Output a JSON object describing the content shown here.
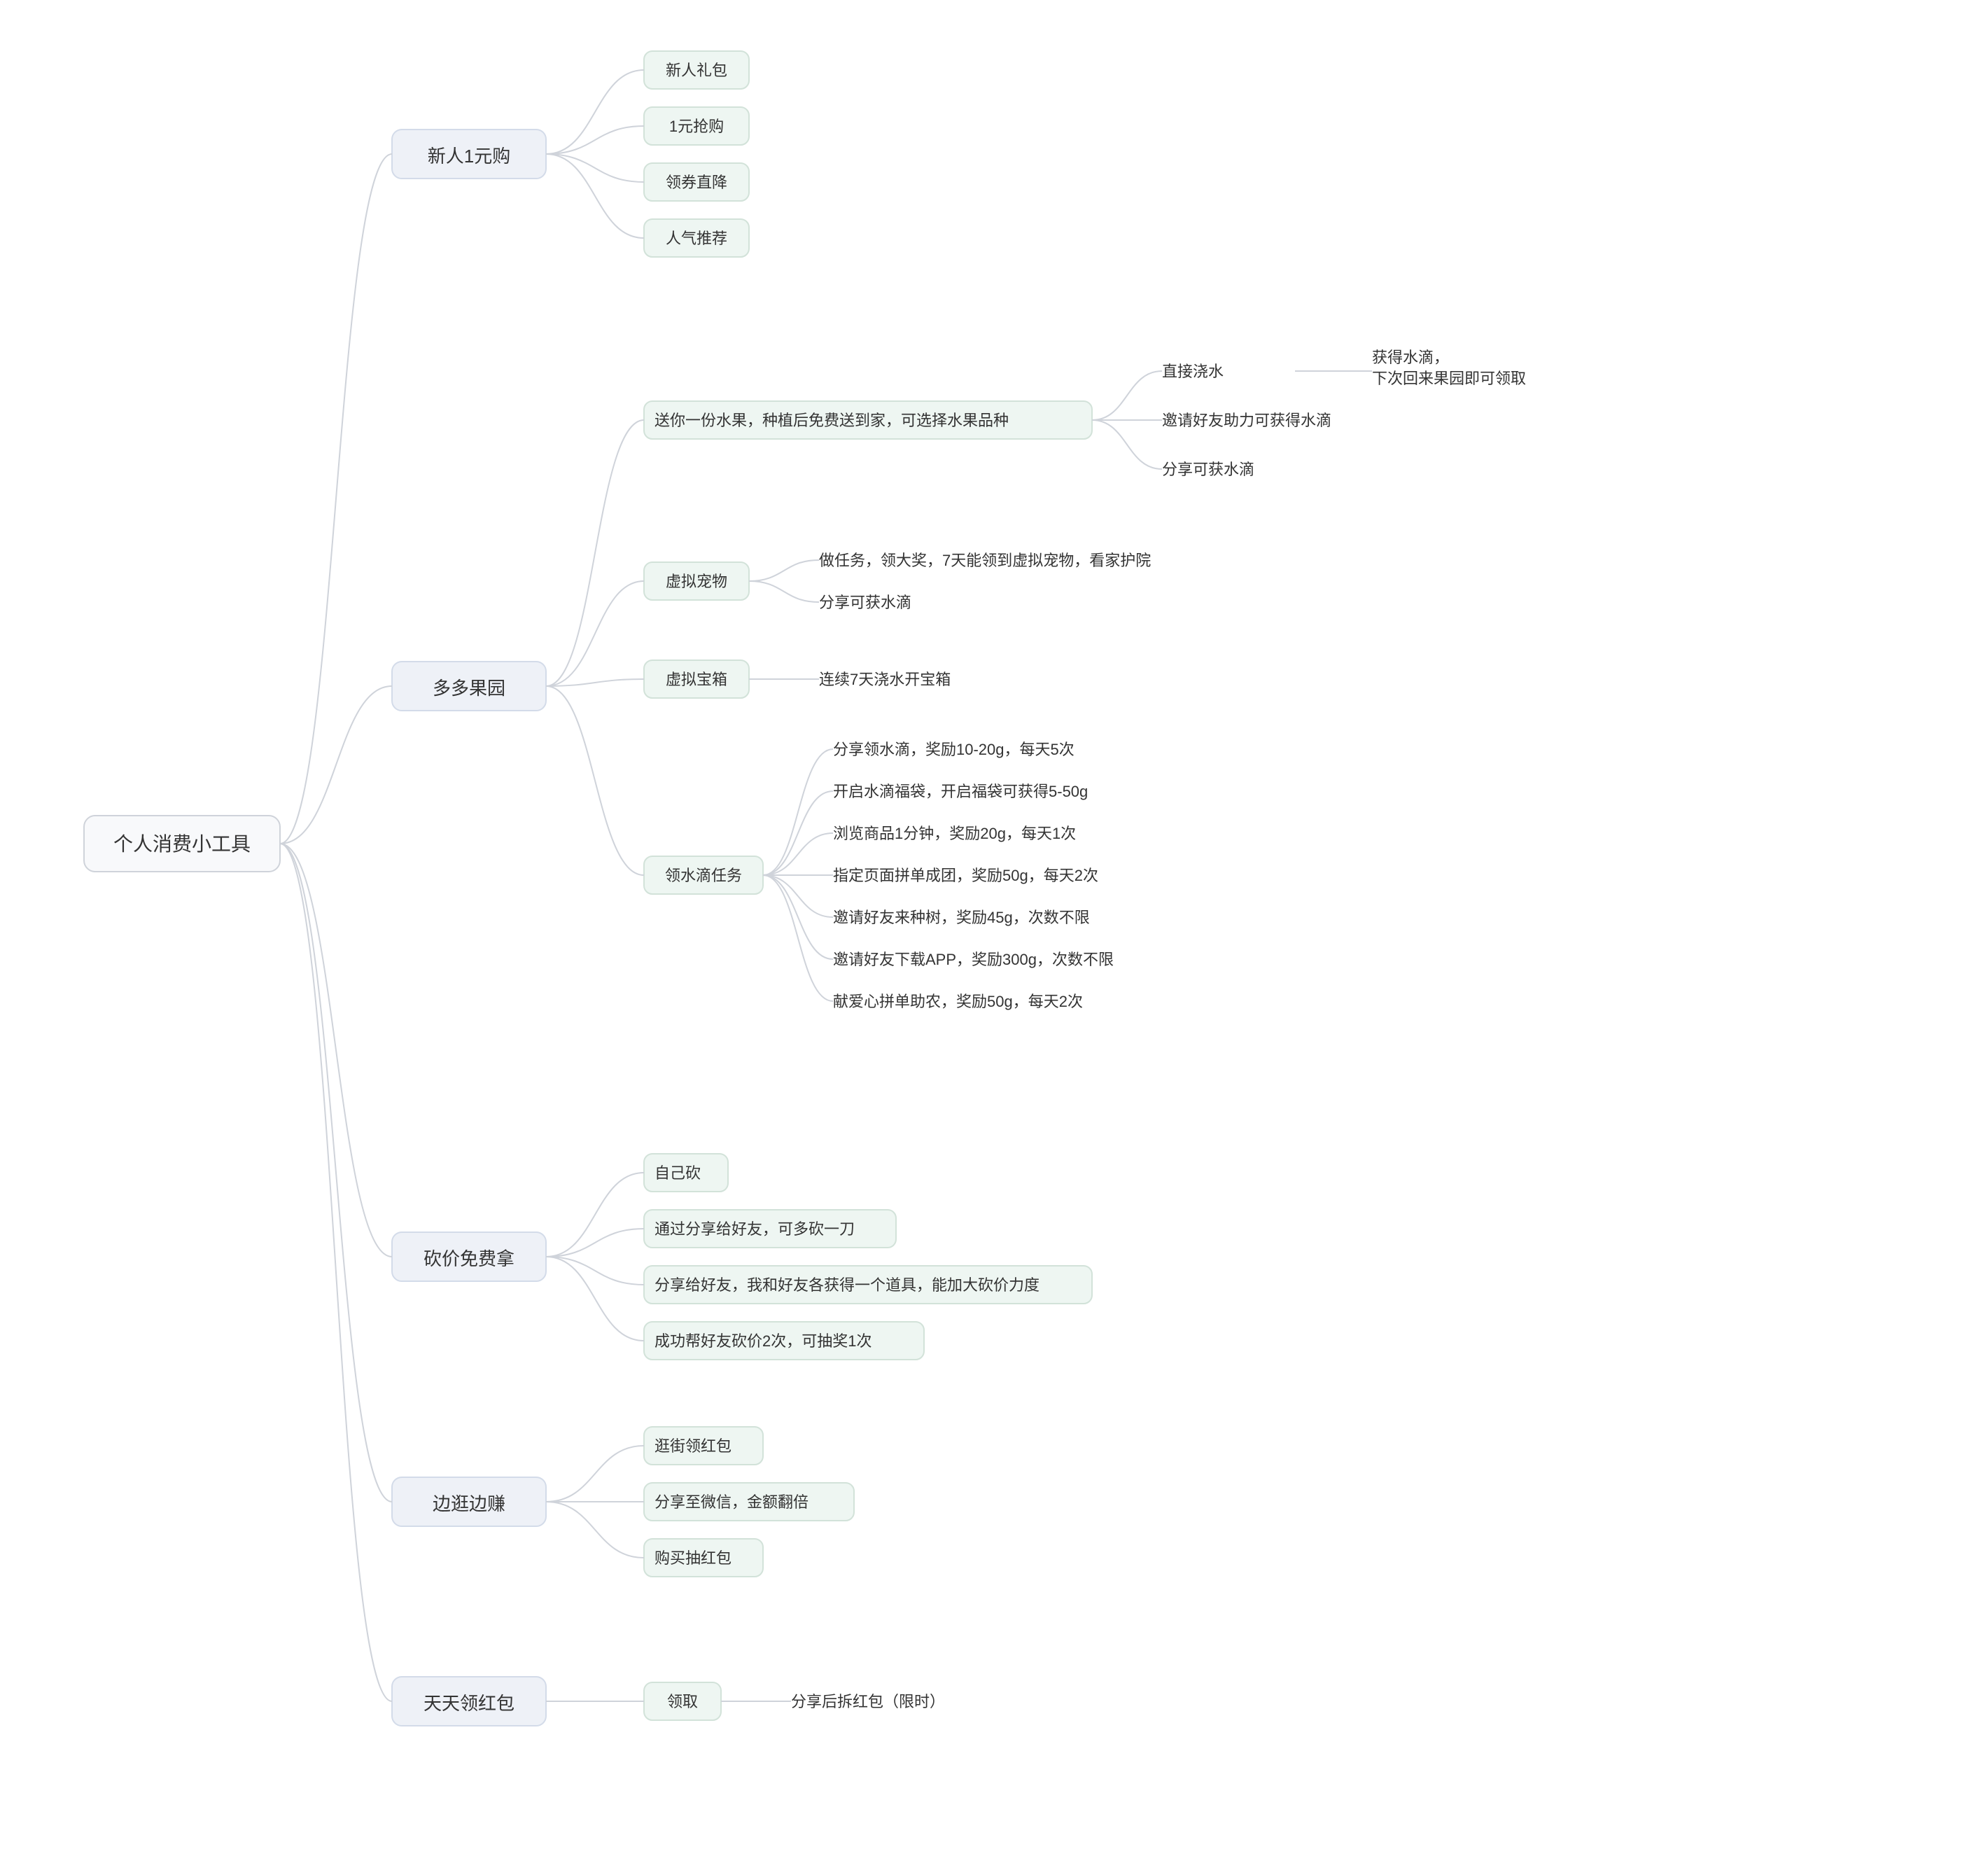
{
  "root": {
    "label": "个人消费小工具"
  },
  "cats": [
    {
      "label": "新人1元购"
    },
    {
      "label": "多多果园"
    },
    {
      "label": "砍价免费拿"
    },
    {
      "label": "边逛边赚"
    },
    {
      "label": "天天领红包"
    }
  ],
  "c1_children": [
    {
      "label": "新人礼包"
    },
    {
      "label": "1元抢购"
    },
    {
      "label": "领券直降"
    },
    {
      "label": "人气推荐"
    }
  ],
  "c2_children": {
    "planting": {
      "label": "送你一份水果，种植后免费送到家，可选择水果品种",
      "children": [
        {
          "label": "直接浇水",
          "note_l1": "获得水滴，",
          "note_l2": "下次回来果园即可领取"
        },
        {
          "label": "邀请好友助力可获得水滴"
        },
        {
          "label": "分享可获水滴"
        }
      ]
    },
    "pet": {
      "label": "虚拟宠物",
      "children": [
        {
          "label": "做任务，领大奖，7天能领到虚拟宠物，看家护院"
        },
        {
          "label": "分享可获水滴"
        }
      ]
    },
    "chest": {
      "label": "虚拟宝箱",
      "children": [
        {
          "label": "连续7天浇水开宝箱"
        }
      ]
    },
    "tasks": {
      "label": "领水滴任务",
      "children": [
        {
          "label": "分享领水滴，奖励10-20g，每天5次"
        },
        {
          "label": "开启水滴福袋，开启福袋可获得5-50g"
        },
        {
          "label": "浏览商品1分钟，奖励20g，每天1次"
        },
        {
          "label": "指定页面拼单成团，奖励50g，每天2次"
        },
        {
          "label": "邀请好友来种树，奖励45g，次数不限"
        },
        {
          "label": "邀请好友下载APP，奖励300g，次数不限"
        },
        {
          "label": "献爱心拼单助农，奖励50g，每天2次"
        }
      ]
    }
  },
  "c3_children": [
    {
      "label": "自己砍"
    },
    {
      "label": "通过分享给好友，可多砍一刀"
    },
    {
      "label": "分享给好友，我和好友各获得一个道具，能加大砍价力度"
    },
    {
      "label": "成功帮好友砍价2次，可抽奖1次"
    }
  ],
  "c4_children": [
    {
      "label": "逛街领红包"
    },
    {
      "label": "分享至微信，金额翻倍"
    },
    {
      "label": "购买抽红包"
    }
  ],
  "c5_children": [
    {
      "label": "领取",
      "note": "分享后拆红包（限时）"
    }
  ]
}
